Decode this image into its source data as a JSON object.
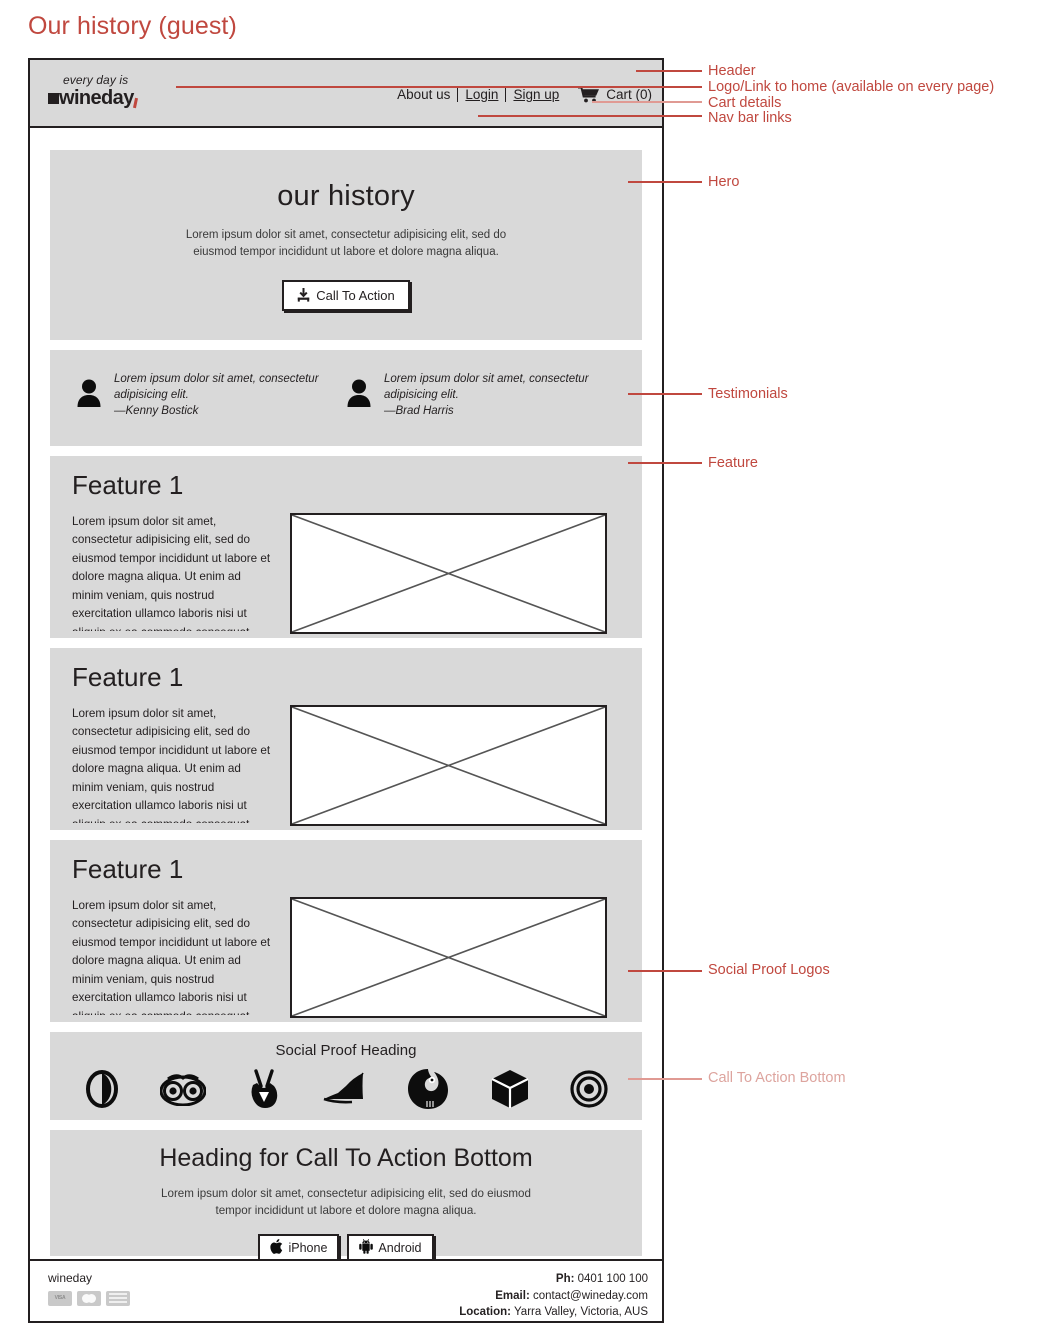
{
  "page_title": "Our history (guest)",
  "accent_color": "#c0483f",
  "panel_color": "#d9d9d9",
  "header": {
    "logo": {
      "tagline": "every day is",
      "name": "wineday"
    },
    "nav": {
      "about": "About us",
      "login": "Login",
      "signup": "Sign up",
      "cart": "Cart (0)"
    }
  },
  "hero": {
    "title": "our history",
    "body": "Lorem ipsum dolor sit amet, consectetur adipisicing elit, sed do eiusmod tempor incididunt ut labore et dolore magna aliqua.",
    "cta_label": "Call To Action"
  },
  "testimonials": [
    {
      "quote": "Lorem ipsum dolor sit amet, consectetur adipisicing elit.",
      "author": "—Kenny Bostick"
    },
    {
      "quote": "Lorem ipsum dolor sit amet, consectetur adipisicing elit.",
      "author": "—Brad Harris"
    }
  ],
  "features": [
    {
      "heading": "Feature 1",
      "body": "Lorem ipsum dolor sit amet, consectetur adipisicing elit, sed do eiusmod tempor incididunt ut labore et dolore magna aliqua. Ut enim ad minim veniam, quis nostrud exercitation ullamco laboris nisi ut aliquip ex ea commodo consequat."
    },
    {
      "heading": "Feature 1",
      "body": "Lorem ipsum dolor sit amet, consectetur adipisicing elit, sed do eiusmod tempor incididunt ut labore et dolore magna aliqua. Ut enim ad minim veniam, quis nostrud exercitation ullamco laboris nisi ut aliquip ex ea commodo consequat."
    },
    {
      "heading": "Feature 1",
      "body": "Lorem ipsum dolor sit amet, consectetur adipisicing elit, sed do eiusmod tempor incididunt ut labore et dolore magna aliqua. Ut enim ad minim veniam, quis nostrud exercitation ullamco laboris nisi ut aliquip ex ea commodo consequat."
    }
  ],
  "social_proof": {
    "heading": "Social Proof Heading",
    "logos": [
      "adversal-logo-icon",
      "tripadvisor-owl-logo-icon",
      "angellist-peace-hand-logo-icon",
      "pied-piper-hat-logo-icon",
      "gripfire-logo-icon",
      "codepen-cube-logo-icon",
      "bullseye-target-logo-icon"
    ]
  },
  "cta_bottom": {
    "heading": "Heading for Call To Action Bottom",
    "body": "Lorem ipsum dolor sit amet, consectetur adipisicing elit, sed do eiusmod tempor incididunt ut labore et dolore magna aliqua.",
    "iphone_label": "iPhone",
    "android_label": "Android"
  },
  "footer": {
    "brand": "wineday",
    "cards": [
      "VISA",
      "mastercard",
      "AMEX"
    ],
    "contact": [
      {
        "label": "Ph:",
        "value": "0401 100 100"
      },
      {
        "label": "Email:",
        "value": "contact@wineday.com"
      },
      {
        "label": "Location:",
        "value": "Yarra Valley, Victoria, AUS"
      }
    ]
  },
  "annotations": [
    {
      "text": "Header"
    },
    {
      "text": "Logo/Link to home (available on every page)"
    },
    {
      "text": "Cart details"
    },
    {
      "text": "Nav bar links"
    },
    {
      "text": "Hero"
    },
    {
      "text": "Testimonials"
    },
    {
      "text": "Feature"
    },
    {
      "text": "Social Proof Logos"
    },
    {
      "text": "Call To Action Bottom"
    }
  ]
}
